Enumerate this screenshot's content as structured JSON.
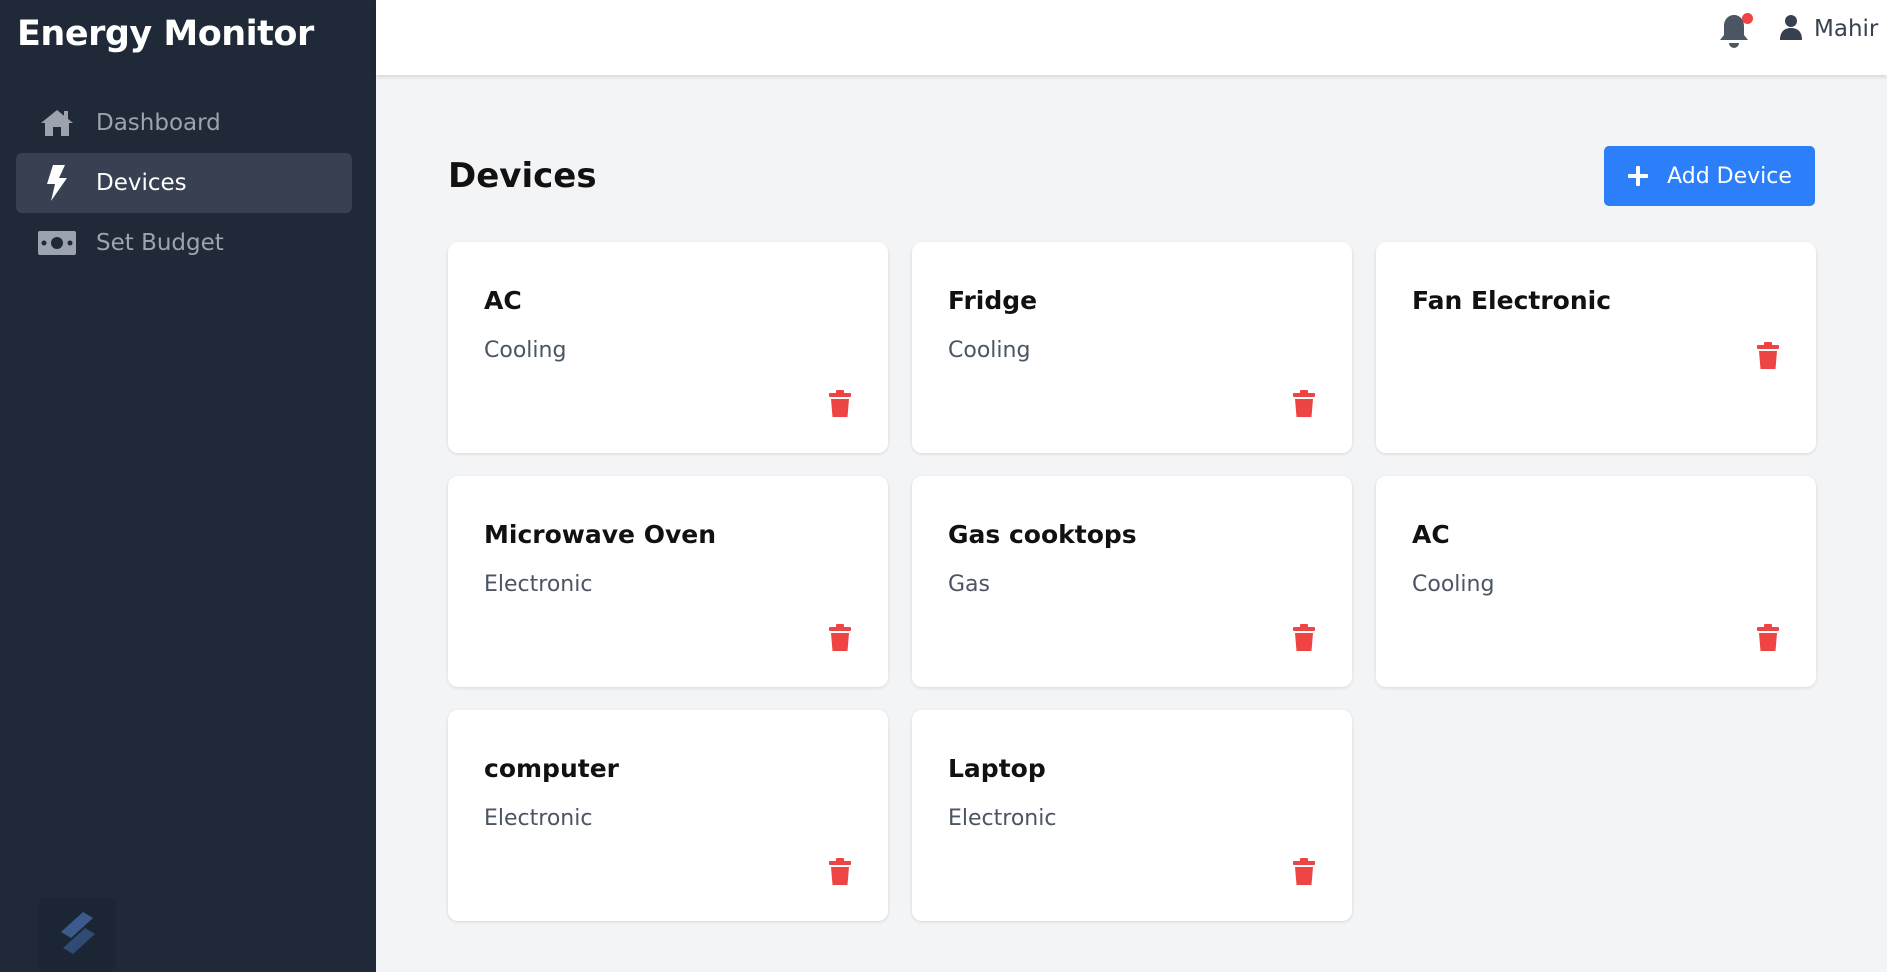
{
  "app": {
    "title": "Energy Monitor"
  },
  "sidebar": {
    "items": [
      {
        "label": "Dashboard",
        "icon": "home-icon",
        "active": false
      },
      {
        "label": "Devices",
        "icon": "bolt-icon",
        "active": true
      },
      {
        "label": "Set Budget",
        "icon": "money-bill-icon",
        "active": false
      }
    ]
  },
  "header": {
    "user_name": "Mahir",
    "has_notification": true
  },
  "main": {
    "title": "Devices",
    "add_button_label": "Add Device",
    "devices": [
      {
        "name": "AC",
        "category": "Cooling"
      },
      {
        "name": "Fridge",
        "category": "Cooling"
      },
      {
        "name": "Fan Electronic",
        "category": ""
      },
      {
        "name": "Microwave Oven",
        "category": "Electronic"
      },
      {
        "name": "Gas cooktops",
        "category": "Gas"
      },
      {
        "name": "AC",
        "category": "Cooling"
      },
      {
        "name": "computer",
        "category": "Electronic"
      },
      {
        "name": "Laptop",
        "category": "Electronic"
      }
    ]
  },
  "colors": {
    "sidebar_bg": "#1f2937",
    "active_item_bg": "#374151",
    "accent": "#2d7ff9",
    "delete": "#ef4444",
    "notification_dot": "#ef4444"
  }
}
